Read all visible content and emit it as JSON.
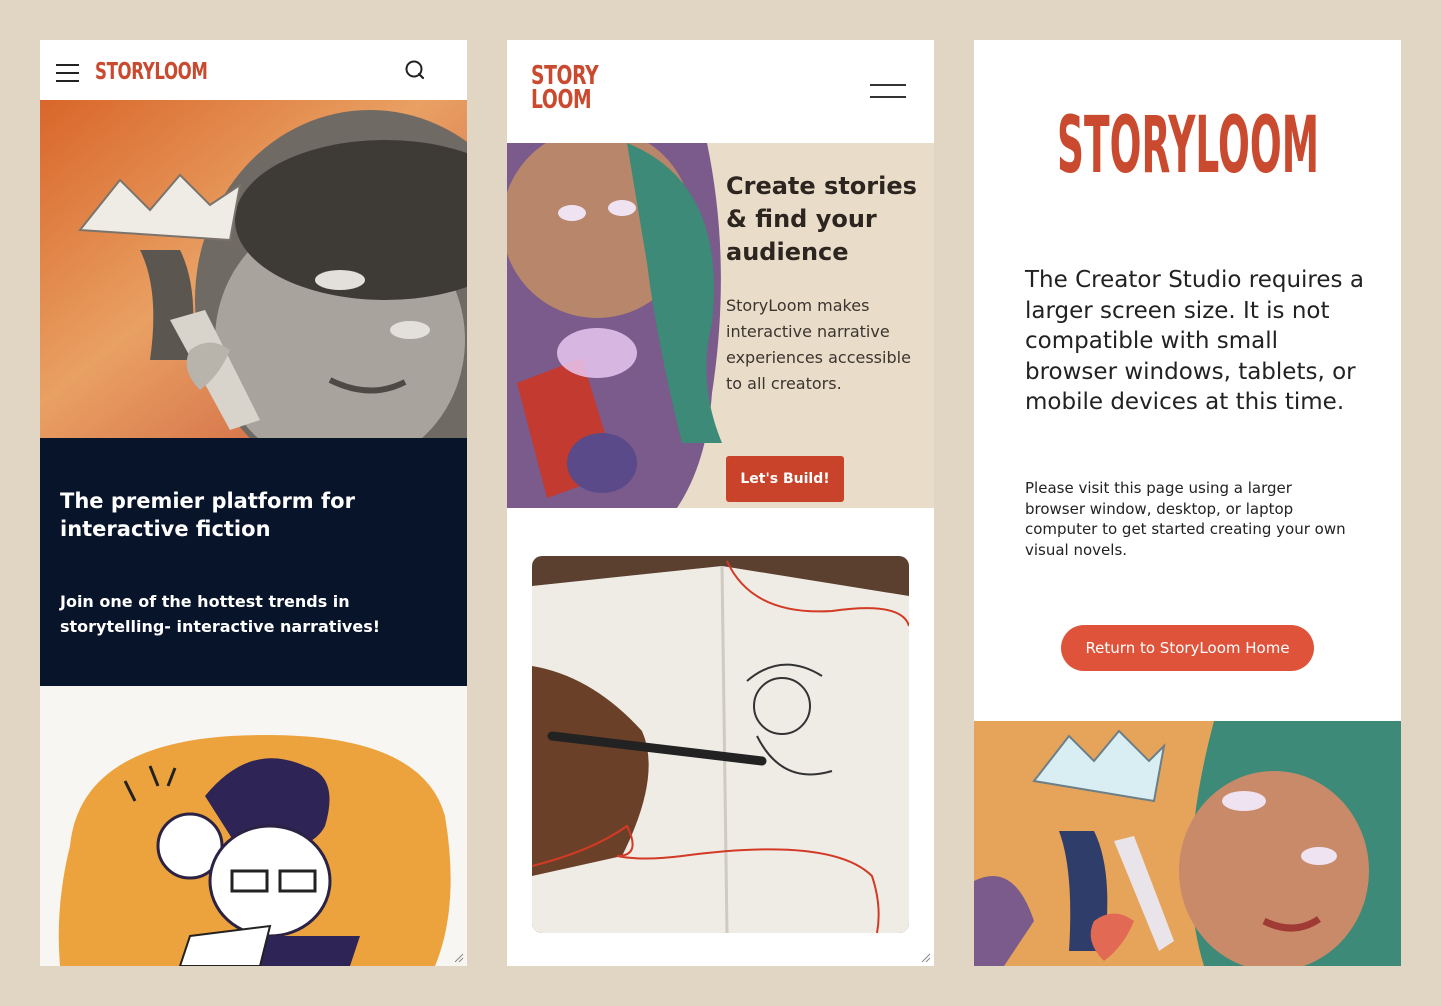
{
  "panel1": {
    "logo": "STORYLOOM",
    "headline": "The premier platform for interactive fiction",
    "subheadline": "Join one of the hottest trends in storytelling- interactive narratives!"
  },
  "panel2": {
    "logo_line1": "STORY",
    "logo_line2": "LOOM",
    "hero_heading": "Create stories & find your audience",
    "hero_text": "StoryLoom makes interactive narrative experiences accessible to all creators.",
    "cta_label": "Let's Build!"
  },
  "panel3": {
    "logo": "STORYLOOM",
    "message": "The Creator Studio requires a larger screen size. It is not compatible with small browser windows, tablets, or mobile devices at this time.",
    "sub_message": "Please visit this page using a larger browser window, desktop, or laptop computer to get started creating your own visual novels.",
    "button_label": "Return to StoryLoom Home"
  },
  "colors": {
    "background": "#e1d5c4",
    "brand_red": "#c94a2f",
    "dark_navy": "#08142a",
    "button_coral": "#e0533b"
  },
  "icons": [
    "hamburger-menu-icon",
    "search-icon",
    "resize-handle-icon"
  ]
}
